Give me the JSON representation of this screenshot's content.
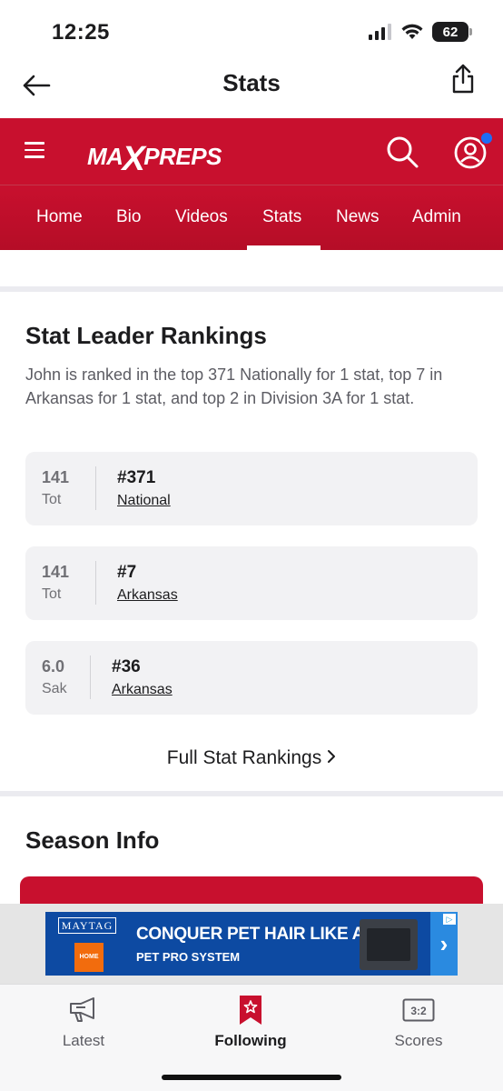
{
  "status_bar": {
    "time": "12:25",
    "battery": "62"
  },
  "nav": {
    "title": "Stats",
    "back_icon": "arrow-left-icon",
    "share_icon": "share-icon"
  },
  "header": {
    "logo_text_left": "MA",
    "logo_text_x": "X",
    "logo_text_right": "PREPS",
    "brand_color": "#c8102e",
    "notification_color": "#1e6df5"
  },
  "tabs": [
    {
      "label": "Home",
      "active": false
    },
    {
      "label": "Bio",
      "active": false
    },
    {
      "label": "Videos",
      "active": false
    },
    {
      "label": "Stats",
      "active": true
    },
    {
      "label": "News",
      "active": false
    },
    {
      "label": "Admin",
      "active": false
    }
  ],
  "stat_leader": {
    "title": "Stat Leader Rankings",
    "description": "John is ranked in the top 371 Nationally for 1 stat, top 7 in Arkansas for 1 stat, and top 2 in Division 3A for 1 stat.",
    "rankings": [
      {
        "value": "141",
        "abbr": "Tot",
        "rank": "#371",
        "region": "National"
      },
      {
        "value": "141",
        "abbr": "Tot",
        "rank": "#7",
        "region": "Arkansas"
      },
      {
        "value": "6.0",
        "abbr": "Sak",
        "rank": "#36",
        "region": "Arkansas"
      }
    ],
    "full_link": "Full Stat Rankings"
  },
  "season_info": {
    "title": "Season Info"
  },
  "ad": {
    "brand": "MAYTAG",
    "retailer": "HOME DEPOT",
    "headline": "CONQUER PET HAIR LIKE A PRO",
    "sub": "PET PRO SYSTEM"
  },
  "bottom_tabs": [
    {
      "label": "Latest",
      "icon": "megaphone-icon",
      "active": false
    },
    {
      "label": "Following",
      "icon": "bookmark-star-icon",
      "active": true
    },
    {
      "label": "Scores",
      "icon": "scoreboard-icon",
      "active": false
    }
  ]
}
